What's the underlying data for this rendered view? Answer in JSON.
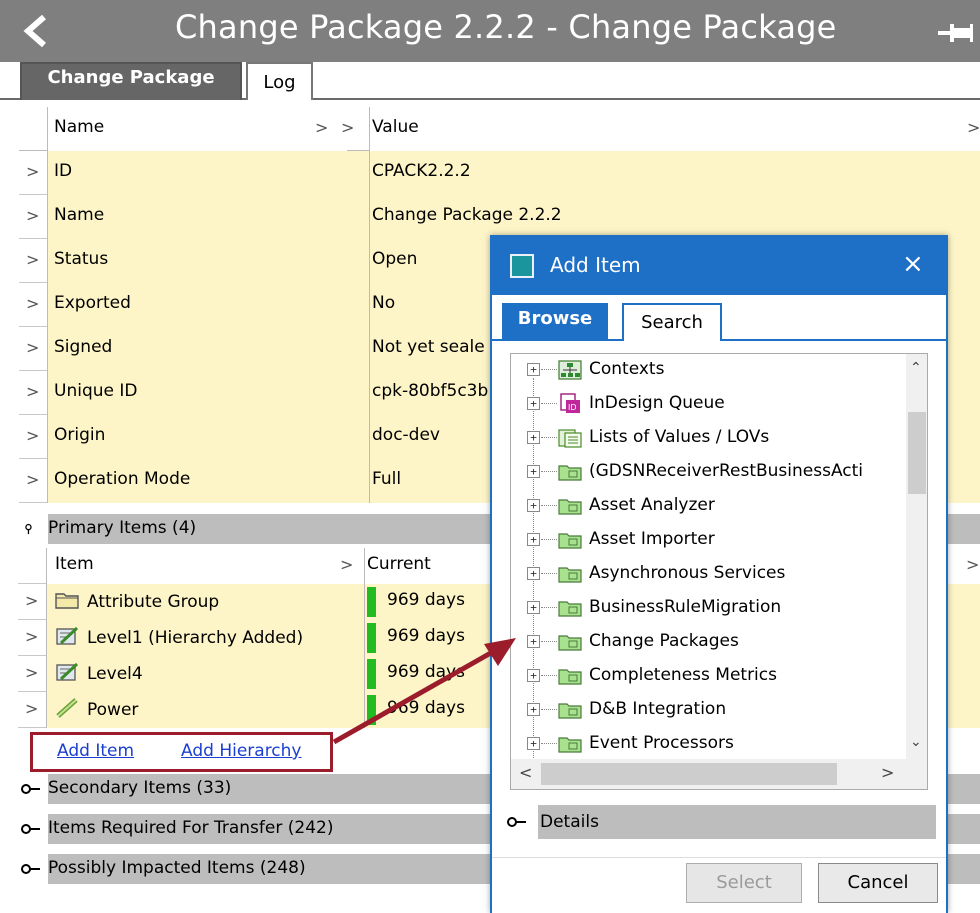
{
  "window": {
    "title": "Change Package 2.2.2 - Change Package"
  },
  "tabs": [
    {
      "label": "Change Package",
      "active": true
    },
    {
      "label": "Log",
      "active": false
    }
  ],
  "properties": {
    "headers": {
      "name": "Name",
      "value": "Value"
    },
    "rows": [
      {
        "name": "ID",
        "value": "CPACK2.2.2"
      },
      {
        "name": "Name",
        "value": "Change Package 2.2.2"
      },
      {
        "name": "Status",
        "value": "Open"
      },
      {
        "name": "Exported",
        "value": "No"
      },
      {
        "name": "Signed",
        "value": "Not yet seale"
      },
      {
        "name": "Unique ID",
        "value": "cpk-80bf5c3b"
      },
      {
        "name": "Origin",
        "value": "doc-dev"
      },
      {
        "name": "Operation Mode",
        "value": "Full"
      }
    ]
  },
  "primary_items": {
    "title": "Primary Items (4)",
    "headers": {
      "item": "Item",
      "current": "Current"
    },
    "rows": [
      {
        "item": "Attribute Group",
        "current": "969 days",
        "icon": "folder-icon"
      },
      {
        "item": "Level1 (Hierarchy Added)",
        "current": "969 days",
        "icon": "hierarchy-edit-icon"
      },
      {
        "item": "Level4",
        "current": "969 days",
        "icon": "hierarchy-edit-icon"
      },
      {
        "item": "Power",
        "current": "969 days",
        "icon": "ruler-icon"
      }
    ],
    "add_item": "Add Item",
    "add_hierarchy": "Add Hierarchy"
  },
  "sections": [
    {
      "label": "Secondary Items (33)"
    },
    {
      "label": "Items Required For Transfer (242)"
    },
    {
      "label": "Possibly Impacted Items (248)"
    }
  ],
  "dialog": {
    "title": "Add Item",
    "close_glyph": "×",
    "tabs": [
      {
        "label": "Browse",
        "active": true
      },
      {
        "label": "Search",
        "active": false
      }
    ],
    "tree": [
      {
        "label": "Contexts",
        "icon": "contexts-icon"
      },
      {
        "label": "InDesign Queue",
        "icon": "indesign-icon"
      },
      {
        "label": "Lists of Values / LOVs",
        "icon": "lov-icon"
      },
      {
        "label": "(GDSNReceiverRestBusinessActi",
        "icon": "folder-green-icon"
      },
      {
        "label": "Asset Analyzer",
        "icon": "folder-green-icon"
      },
      {
        "label": "Asset Importer",
        "icon": "folder-green-icon"
      },
      {
        "label": "Asynchronous Services",
        "icon": "folder-green-icon"
      },
      {
        "label": "BusinessRuleMigration",
        "icon": "folder-green-icon"
      },
      {
        "label": "Change Packages",
        "icon": "folder-green-icon"
      },
      {
        "label": "Completeness Metrics",
        "icon": "folder-green-icon"
      },
      {
        "label": "D&B Integration",
        "icon": "folder-green-icon"
      },
      {
        "label": "Event Processors",
        "icon": "folder-green-icon"
      }
    ],
    "details_label": "Details",
    "select_label": "Select",
    "cancel_label": "Cancel"
  },
  "colors": {
    "title_bar": "#7f7f7f",
    "row_highlight": "#fdf5c7",
    "dialog_accent": "#1e6fc6",
    "callout_red": "#9b1c2a",
    "status_green": "#22bb22"
  }
}
